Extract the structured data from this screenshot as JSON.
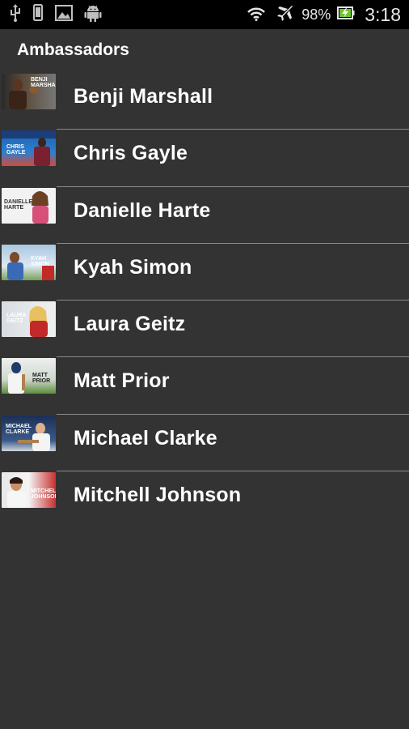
{
  "status_bar": {
    "battery_percent": "98%",
    "time": "3:18",
    "icons": [
      "usb-icon",
      "phone-icon",
      "gallery-icon",
      "android-icon",
      "wifi-icon",
      "airplane-icon",
      "battery-icon"
    ]
  },
  "header": {
    "title": "Ambassadors"
  },
  "ambassadors": [
    {
      "name": "Benji Marshall",
      "thumb_text": "BENJI MARSHALL"
    },
    {
      "name": "Chris Gayle",
      "thumb_text": "CHRIS GAYLE"
    },
    {
      "name": "Danielle Harte",
      "thumb_text": "DANIELLE HARTE"
    },
    {
      "name": "Kyah Simon",
      "thumb_text": "KYAH SIMON"
    },
    {
      "name": "Laura Geitz",
      "thumb_text": "LAURA GEITZ"
    },
    {
      "name": "Matt Prior",
      "thumb_text": "MATT PRIOR"
    },
    {
      "name": "Michael Clarke",
      "thumb_text": "MICHAEL CLARKE"
    },
    {
      "name": "Mitchell Johnson",
      "thumb_text": "MITCHELL JOHNSON"
    }
  ]
}
